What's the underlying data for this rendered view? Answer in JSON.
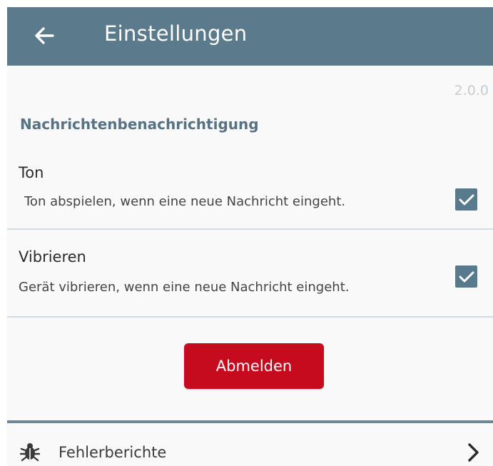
{
  "app_bar": {
    "title": "Einstellungen",
    "back_icon": "arrow-left-icon",
    "background_color": "#5b7a8c"
  },
  "version": "2.0.0",
  "section": {
    "title": "Nachrichtenbenachrichtigung"
  },
  "settings": [
    {
      "label": "Ton",
      "description": "Ton abspielen, wenn eine neue Nachricht eingeht.",
      "checked": true
    },
    {
      "label": "Vibrieren",
      "description": "Gerät vibrieren, wenn eine neue Nachricht eingeht.",
      "checked": true
    }
  ],
  "logout": {
    "label": "Abmelden",
    "color": "#c60b1f"
  },
  "bug_report": {
    "label": "Fehlerberichte",
    "icon": "bug-icon",
    "trailing_icon": "chevron-right-icon"
  }
}
